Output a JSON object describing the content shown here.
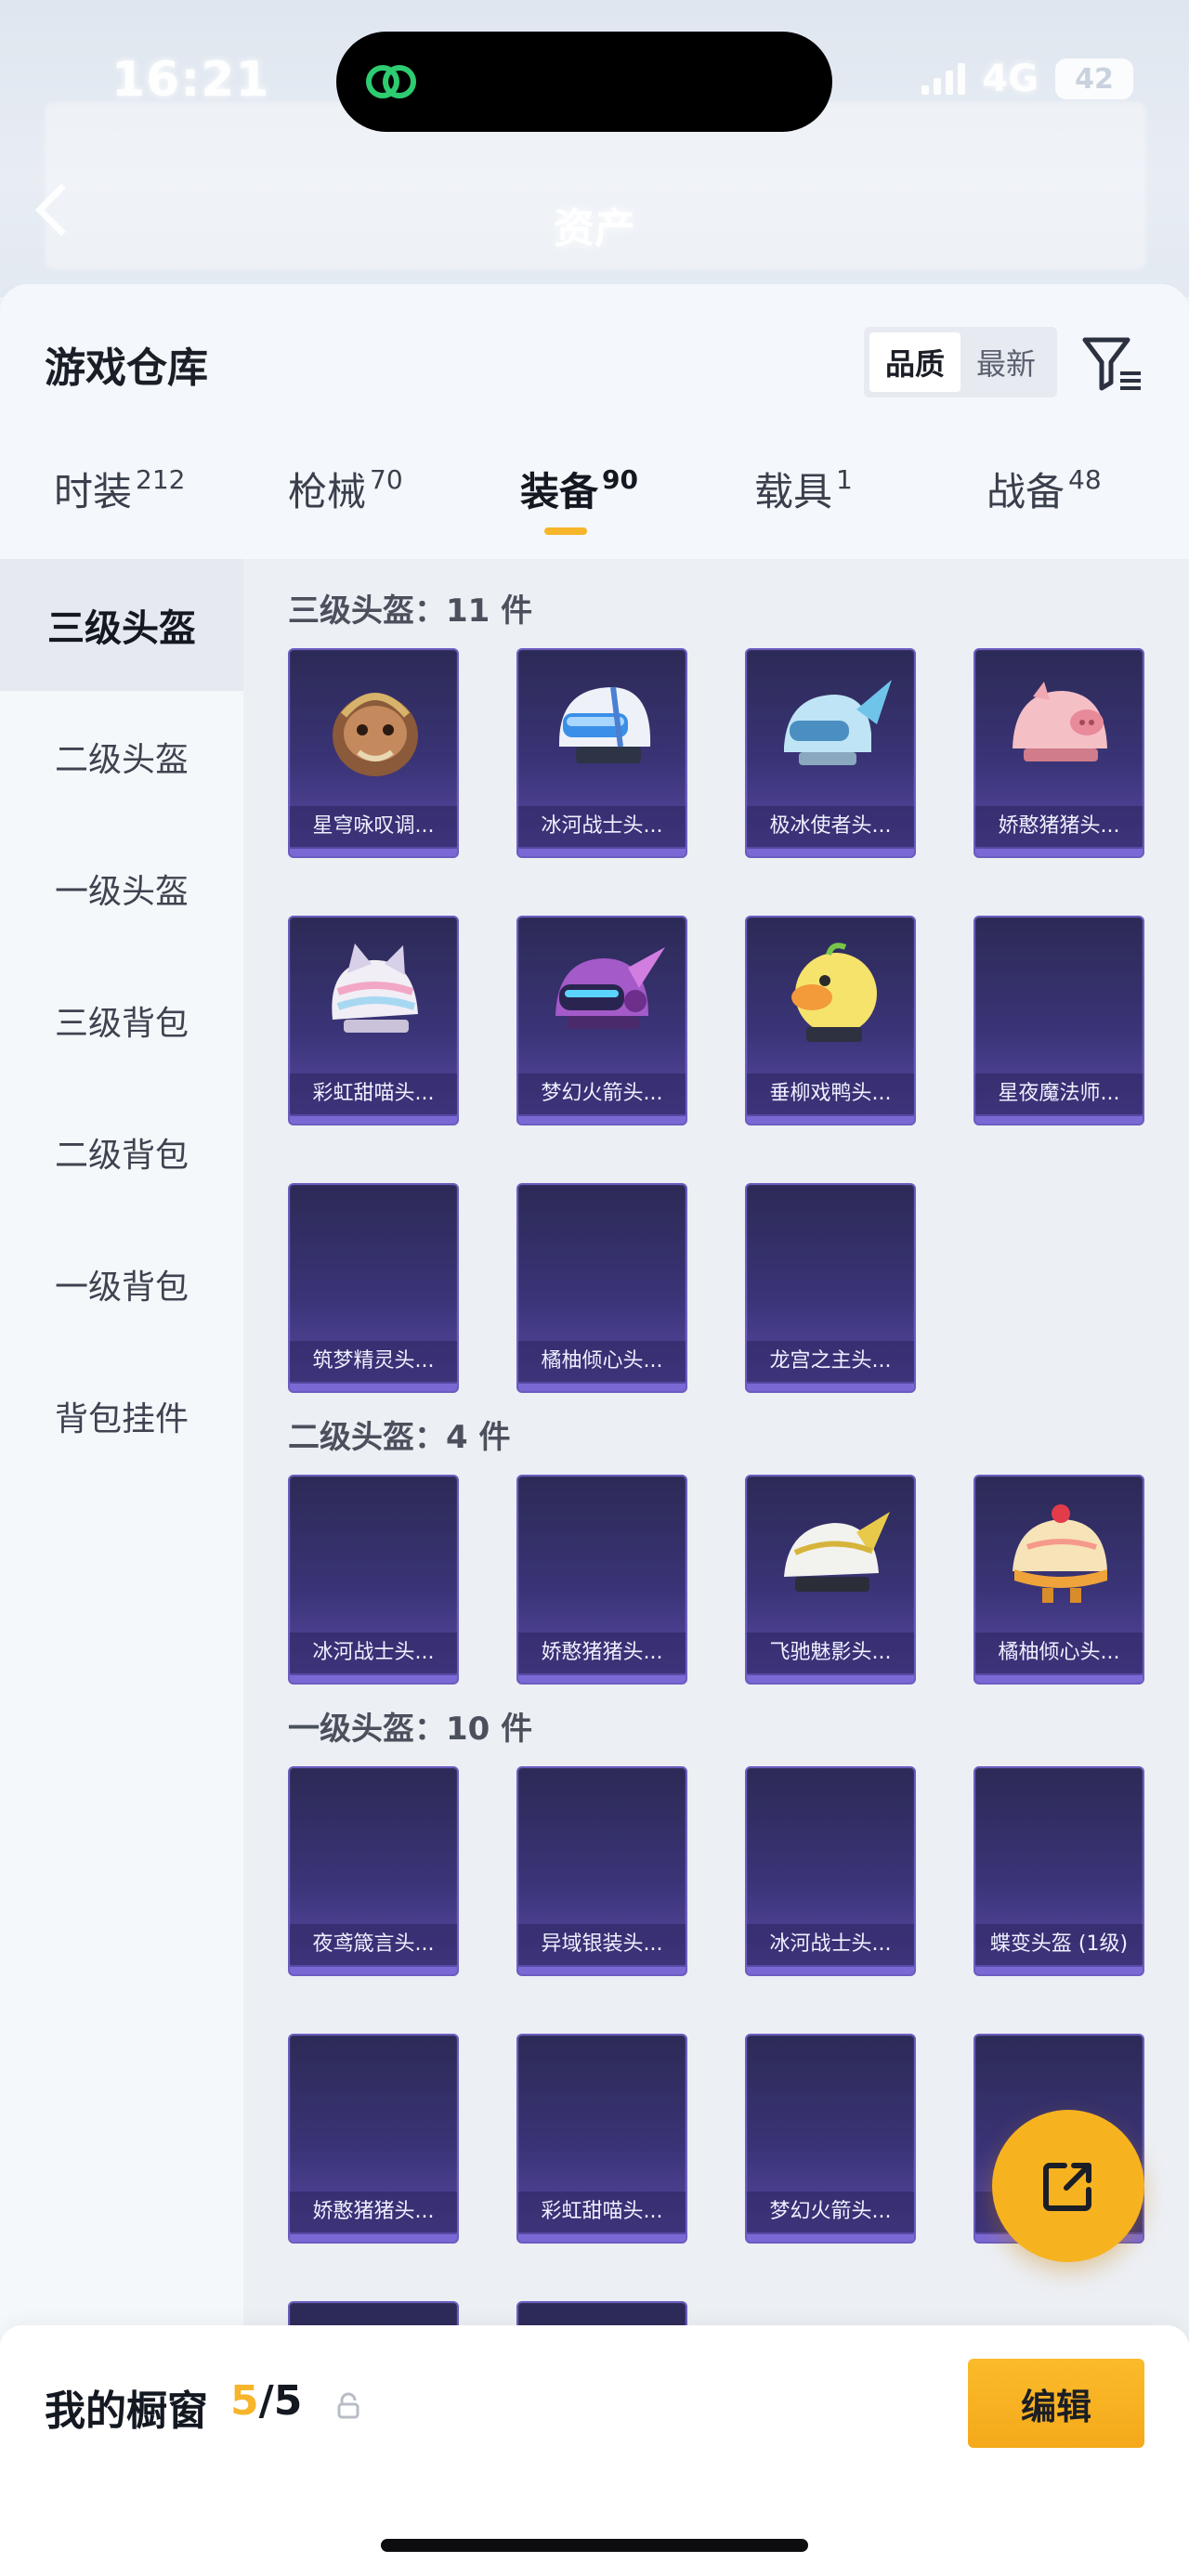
{
  "status_bar": {
    "time": "16:21",
    "network": "4G",
    "battery": "42"
  },
  "nav": {
    "title": "资产"
  },
  "sheet": {
    "title": "游戏仓库",
    "sort_options": [
      "品质",
      "最新"
    ],
    "active_sort": "品质"
  },
  "tabs": [
    {
      "label": "时装",
      "count": "212"
    },
    {
      "label": "枪械",
      "count": "70"
    },
    {
      "label": "装备",
      "count": "90"
    },
    {
      "label": "载具",
      "count": "1"
    },
    {
      "label": "战备",
      "count": "48"
    }
  ],
  "active_tab": "装备",
  "sidebar": [
    {
      "label": "三级头盔",
      "active": true
    },
    {
      "label": "二级头盔"
    },
    {
      "label": "一级头盔"
    },
    {
      "label": "三级背包"
    },
    {
      "label": "二级背包"
    },
    {
      "label": "一级背包"
    },
    {
      "label": "背包挂件"
    }
  ],
  "sections": [
    {
      "title": "三级头盔：",
      "count": "11",
      "unit": "件",
      "items": [
        "星穹咏叹调...",
        "冰河战士头...",
        "极冰使者头...",
        "娇憨猪猪头...",
        "彩虹甜喵头...",
        "梦幻火箭头...",
        "垂柳戏鸭头...",
        "星夜魔法师...",
        "筑梦精灵头...",
        "橘柚倾心头...",
        "龙宫之主头..."
      ]
    },
    {
      "title": "二级头盔：",
      "count": "4",
      "unit": "件",
      "items": [
        "冰河战士头...",
        "娇憨猪猪头...",
        "飞驰魅影头...",
        "橘柚倾心头..."
      ]
    },
    {
      "title": "一级头盔：",
      "count": "10",
      "unit": "件",
      "items": [
        "夜鸢箴言头...",
        "异域银装头...",
        "冰河战士头...",
        "蝶变头盔 (1级)",
        "娇憨猪猪头...",
        "彩虹甜喵头...",
        "梦幻火箭头...",
        "",
        "",
        ""
      ]
    }
  ],
  "bottom_bar": {
    "label": "我的橱窗",
    "current": "5",
    "separator": "/",
    "total": "5",
    "edit_label": "编辑"
  },
  "colors": {
    "accent": "#f6b52a",
    "card_top": "#2c2a56",
    "card_bottom": "#5a4aa7"
  }
}
